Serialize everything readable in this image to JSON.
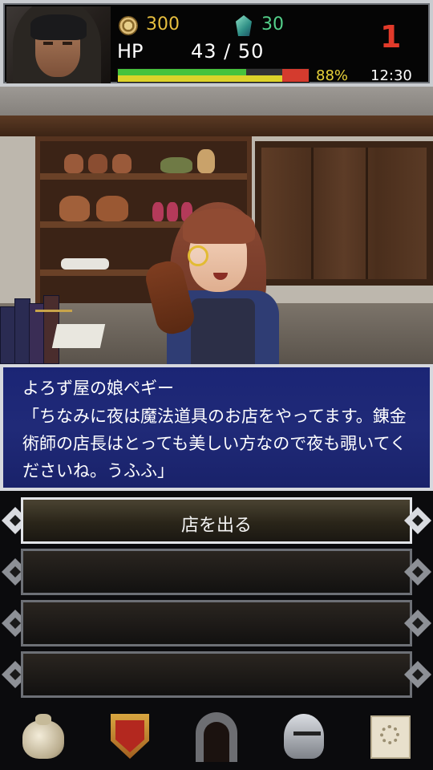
{
  "status": {
    "gold": "300",
    "gems": "30",
    "level": "1",
    "hp_label": "HP",
    "hp_value": "43 / 50",
    "hp_fraction": 0.86,
    "hp_percent": "88%",
    "clock": "12:30"
  },
  "dialogue": {
    "speaker": "よろず屋の娘ペギー",
    "message": "「ちなみに夜は魔法道具のお店をやってます。錬金術師の店長はとっても美しい方なので夜も覗いてくださいね。うふふ」"
  },
  "menu": {
    "items": [
      {
        "label": "店を出る"
      },
      {
        "label": ""
      },
      {
        "label": ""
      },
      {
        "label": ""
      }
    ]
  },
  "nav": {
    "items": [
      {
        "icon": "bag-icon"
      },
      {
        "icon": "crest-icon"
      },
      {
        "icon": "dungeon-door-icon"
      },
      {
        "icon": "helmet-icon"
      },
      {
        "icon": "map-scroll-icon"
      }
    ]
  }
}
